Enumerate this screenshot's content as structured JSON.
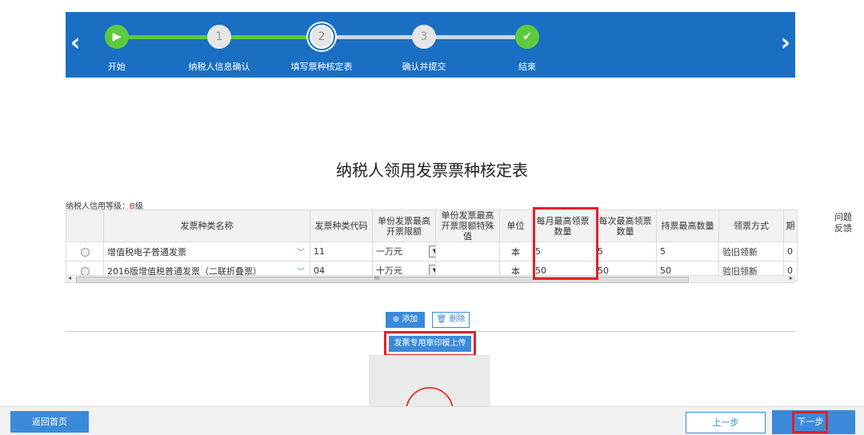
{
  "stepper": {
    "steps": [
      {
        "label": "开始",
        "marker": "▶"
      },
      {
        "label": "纳税人信息确认",
        "marker": "1"
      },
      {
        "label": "填写票种核定表",
        "marker": "2"
      },
      {
        "label": "确认并提交",
        "marker": "3"
      },
      {
        "label": "结束",
        "marker": "✔"
      }
    ],
    "prev_icon": "‹",
    "next_icon": "›"
  },
  "page_title": "纳税人领用发票票种核定表",
  "credit": {
    "label": "纳税人信用等级：",
    "level": "B",
    "suffix": "级"
  },
  "feedback": "问题反馈",
  "table": {
    "headers": [
      "发票种类名称",
      "发票种类代码",
      "单份发票最高开票限额",
      "单份发票最高开票限额特殊值",
      "单位",
      "每月最高领票数量",
      "每次最高领票数量",
      "持票最高数量",
      "领票方式",
      "期"
    ],
    "rows": [
      {
        "name": "增值税电子普通发票",
        "code": "11",
        "limit": "一万元",
        "special": "",
        "unit": "本",
        "monthly": "5",
        "each": "5",
        "hold": "5",
        "method": "验旧领新",
        "extra": "0"
      },
      {
        "name": "2016版增值税普通发票（二联折叠票）",
        "code": "04",
        "limit": "十万元",
        "special": "",
        "unit": "本",
        "monthly": "50",
        "each": "50",
        "hold": "50",
        "method": "验旧领新",
        "extra": "0"
      }
    ]
  },
  "scroll_center": "III",
  "buttons": {
    "add": "⊕ 添加",
    "delete": "🗑 删除",
    "upload": "发票专用章印模上传",
    "home": "返回首页",
    "prev": "上一步",
    "next": "下一步"
  },
  "colors": {
    "accent": "#3b8ad9",
    "stepper_bg": "#1a6fc3",
    "done": "#5ecb3e",
    "highlight": "#e0202a"
  }
}
